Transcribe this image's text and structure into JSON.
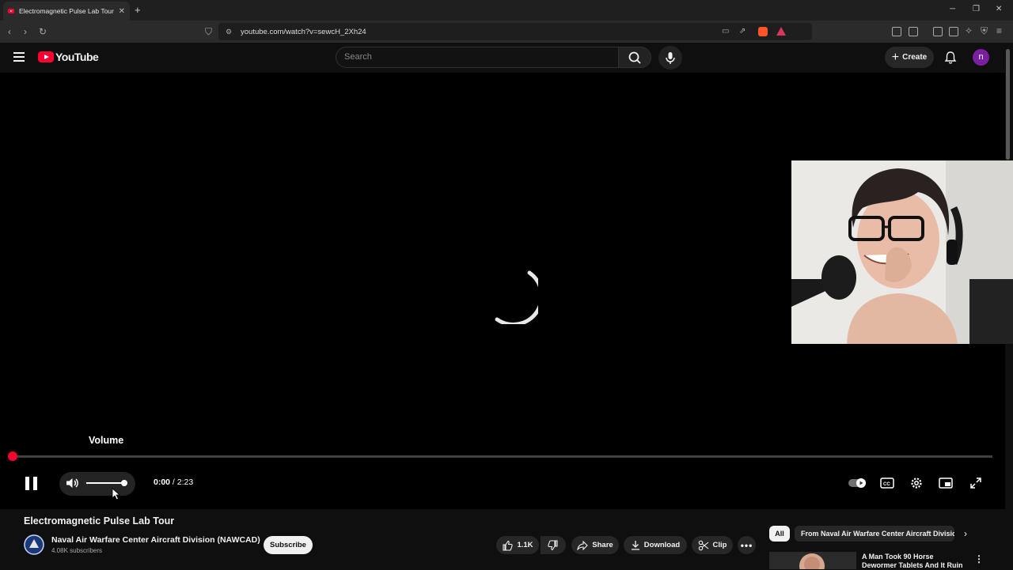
{
  "browser": {
    "tab_title": "Electromagnetic Pulse Lab Tour",
    "url": "youtube.com/watch?v=sewcH_2Xh24"
  },
  "masthead": {
    "logo_text": "YouTube",
    "search_placeholder": "Search",
    "create_label": "Create",
    "avatar_letter": "n"
  },
  "player": {
    "tooltip": "Volume",
    "current_time": "0:00",
    "duration": "2:23",
    "progress": 0.0,
    "volume": 1.0
  },
  "video": {
    "title": "Electromagnetic Pulse Lab Tour",
    "channel": "Naval Air Warfare Center Aircraft Division (NAWCAD)",
    "subscribers": "4.08K subscribers",
    "subscribe_label": "Subscribe",
    "likes": "1.1K",
    "share_label": "Share",
    "download_label": "Download",
    "clip_label": "Clip"
  },
  "sidebar": {
    "chips": [
      "All",
      "From Naval Air Warfare Center Aircraft Divisio"
    ],
    "rec_title": "A Man Took 90 Horse Dewormer Tablets And It Ruin"
  },
  "colors": {
    "accent": "#ff0033",
    "background": "#0f0f0f"
  }
}
